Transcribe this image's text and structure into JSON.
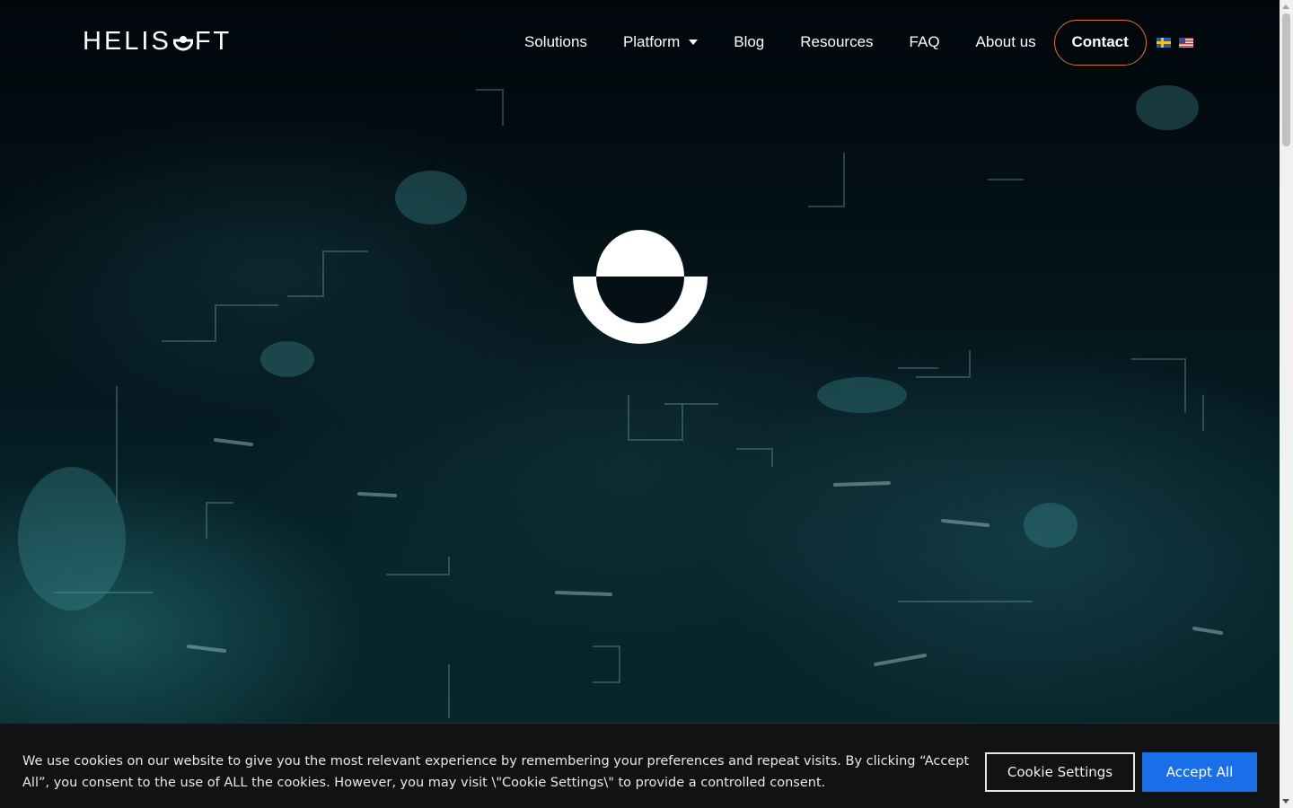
{
  "brand": {
    "logo_text_before": "HELIS",
    "logo_text_after": "FT"
  },
  "nav": {
    "items": [
      {
        "label": "Solutions"
      },
      {
        "label": "Platform",
        "has_dropdown": true
      },
      {
        "label": "Blog"
      },
      {
        "label": "Resources"
      },
      {
        "label": "FAQ"
      },
      {
        "label": "About us"
      }
    ],
    "contact_label": "Contact",
    "contact_border_color": "#d7742f",
    "languages": [
      "swedish-flag-icon",
      "us-flag-icon"
    ]
  },
  "hero": {
    "mark_icon": "helisoft-o-mark-icon"
  },
  "cookie_banner": {
    "text": "We use cookies on our website to give you the most relevant experience by remembering your preferences and repeat visits. By clicking “Accept All”, you consent to the use of ALL the cookies. However, you may visit \\\"Cookie Settings\\\" to provide a controlled consent.",
    "settings_label": "Cookie Settings",
    "accept_label": "Accept All",
    "accept_color": "#1a6ee8"
  }
}
